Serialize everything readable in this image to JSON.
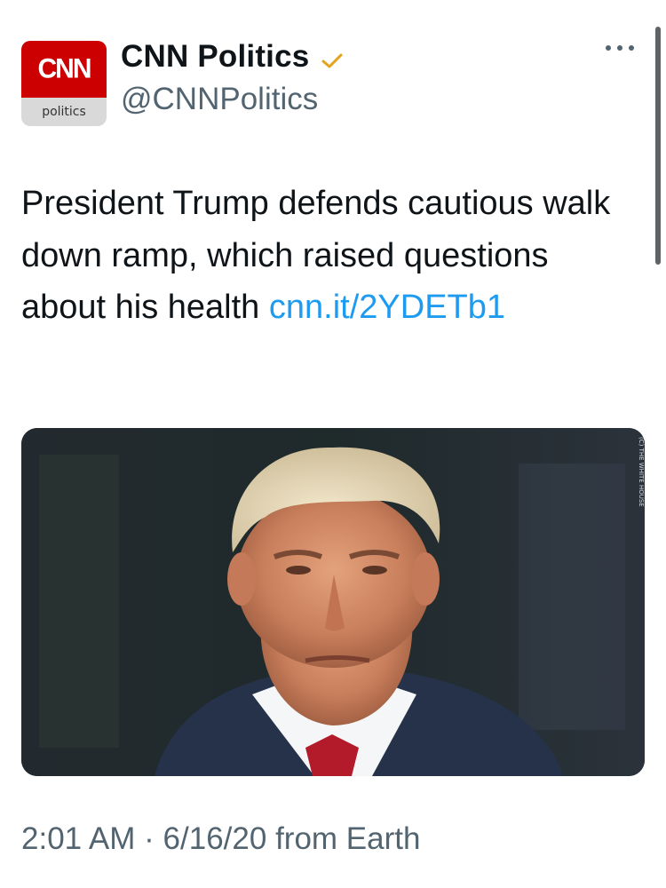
{
  "account": {
    "display_name": "CNN Politics",
    "handle": "@CNNPolitics",
    "avatar_logo": "CNN",
    "avatar_sub": "politics",
    "verified": true,
    "verified_icon": "verified-check-icon",
    "more_icon": "more-dots-icon"
  },
  "tweet": {
    "text": "President Trump defends cautious walk down ramp, which raised questions about his health ",
    "link_text": "cnn.it/​2YDETb1",
    "image_alt": "photo of a man in a suit and red tie",
    "image_side_text": "(C) THE WHITE HOUSE",
    "time": "2:01 AM",
    "separator": "·",
    "date": "6/16/20",
    "source": "from Earth"
  },
  "colors": {
    "link": "#1d9bf0",
    "meta_gray": "#536471",
    "cnn_red": "#cc0000",
    "verified_gold": "#e6a21a"
  }
}
